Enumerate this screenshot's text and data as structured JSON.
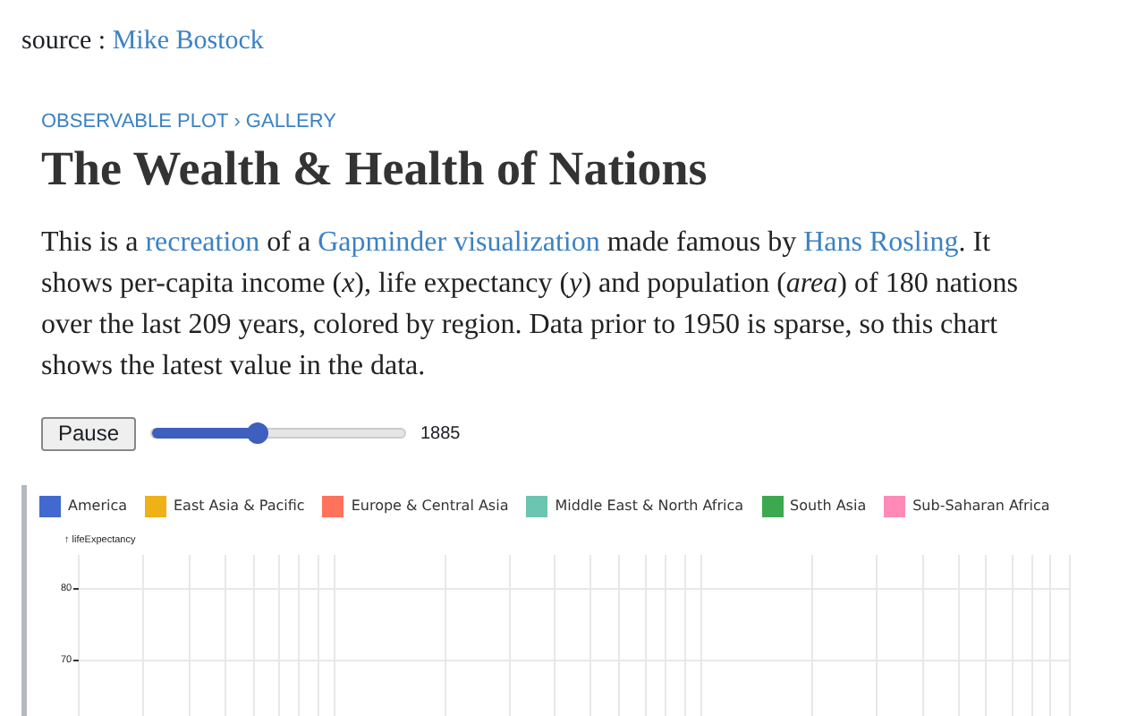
{
  "source": {
    "label": "source :",
    "link": "Mike Bostock"
  },
  "breadcrumb": [
    {
      "label": "OBSERVABLE PLOT"
    },
    {
      "label": "GALLERY"
    }
  ],
  "breadcrumb_separator": "›",
  "title": "The Wealth & Health of Nations",
  "description": [
    {
      "kind": "text",
      "text": "This is a "
    },
    {
      "kind": "link",
      "text": "recreation"
    },
    {
      "kind": "text",
      "text": " of a "
    },
    {
      "kind": "link",
      "text": "Gapminder visualization"
    },
    {
      "kind": "text",
      "text": " made famous by "
    },
    {
      "kind": "link",
      "text": "Hans Rosling"
    },
    {
      "kind": "text",
      "text": ". It shows per-capita income (*x*), life expectancy (*y*) and population (*area*) of 180 nations over the last 209 years, colored by region. Data prior to 1950 is sparse, so this chart shows the latest value in the data."
    }
  ],
  "controls": {
    "button": "Pause",
    "slider": {
      "level": 0.42
    },
    "year": "1885"
  },
  "legend": [
    {
      "label": "America",
      "color": "#4269d0"
    },
    {
      "label": "East Asia & Pacific",
      "color": "#efb118"
    },
    {
      "label": "Europe & Central Asia",
      "color": "#ff725c"
    },
    {
      "label": "Middle East & North Africa",
      "color": "#6cc5b0"
    },
    {
      "label": "South Asia",
      "color": "#3ca951"
    },
    {
      "label": "Sub-Saharan Africa",
      "color": "#ff8ab7"
    }
  ],
  "plot": {
    "y_label": "↑ lifeExpectancy",
    "y_ticks": [
      "80",
      "70"
    ]
  }
}
